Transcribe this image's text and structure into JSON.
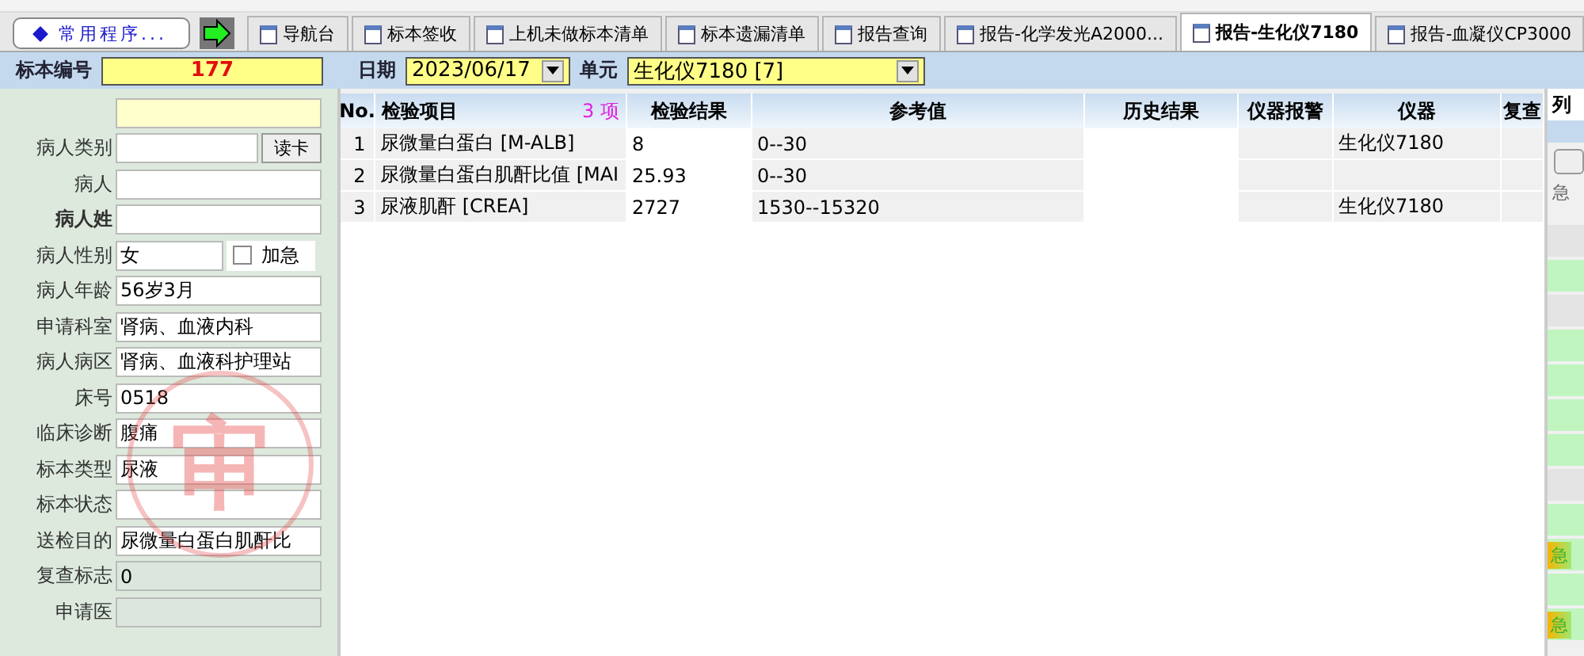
{
  "quick_button": {
    "label": "常用程序..."
  },
  "tabs": [
    {
      "label": "导航台",
      "selected": false
    },
    {
      "label": "标本签收",
      "selected": false
    },
    {
      "label": "上机未做标本清单",
      "selected": false
    },
    {
      "label": "标本遗漏清单",
      "selected": false
    },
    {
      "label": "报告查询",
      "selected": false
    },
    {
      "label": "报告-化学发光A2000...",
      "selected": false
    },
    {
      "label": "报告-生化仪7180",
      "selected": true
    },
    {
      "label": "报告-血凝仪CP3000",
      "selected": false
    }
  ],
  "header": {
    "sample_label": "标本编号",
    "sample_no": "177",
    "date_label": "日期",
    "date": "2023/06/17",
    "unit_label": "单元",
    "unit": "生化仪7180 [7]"
  },
  "patient_fields": [
    {
      "kind": "text",
      "disabled": false,
      "highlight": true
    },
    {
      "kind": "button",
      "label": "病人类别",
      "disabled": false,
      "highlight": false,
      "button": "读卡"
    },
    {
      "kind": "text",
      "label": "病人",
      "disabled": false,
      "highlight": false
    },
    {
      "kind": "text",
      "label": "病人姓",
      "disabled": false,
      "highlight": false,
      "bold": true
    },
    {
      "kind": "checkbox",
      "label": "病人性别",
      "value": "女",
      "disabled": false,
      "highlight": false,
      "check_label": "加急",
      "checked": false
    },
    {
      "kind": "text",
      "label": "病人年龄",
      "value": "56岁3月",
      "disabled": false,
      "highlight": false
    },
    {
      "kind": "text",
      "label": "申请科室",
      "value": "肾病、血液内科",
      "disabled": false,
      "highlight": false
    },
    {
      "kind": "text",
      "label": "病人病区",
      "value": "肾病、血液科护理站",
      "disabled": false,
      "highlight": false
    },
    {
      "kind": "text",
      "label": "床号",
      "value": "0518",
      "disabled": false,
      "highlight": false
    },
    {
      "kind": "text",
      "label": "临床诊断",
      "value": "腹痛",
      "disabled": false,
      "highlight": false
    },
    {
      "kind": "text",
      "label": "标本类型",
      "value": "尿液",
      "disabled": false,
      "highlight": false
    },
    {
      "kind": "text",
      "label": "标本状态",
      "disabled": false,
      "highlight": false
    },
    {
      "kind": "text",
      "label": "送检目的",
      "value": "尿微量白蛋白肌酐比",
      "disabled": false,
      "highlight": false
    },
    {
      "kind": "text",
      "label": "复查标志",
      "value": "0",
      "disabled": true,
      "highlight": false
    },
    {
      "kind": "text",
      "label": "申请医",
      "disabled": true,
      "highlight": false
    }
  ],
  "stamp": {
    "text": "审"
  },
  "table": {
    "count": "3 项",
    "columns": [
      "No.",
      "检验项目",
      "检验结果",
      "参考值",
      "历史结果",
      "仪器报警",
      "仪器",
      "复查"
    ],
    "rows": [
      [
        "1",
        "尿微量白蛋白 [M-ALB]",
        "8",
        "0--30",
        null,
        null,
        "生化仪7180",
        null
      ],
      [
        "2",
        "尿微量白蛋白肌酐比值 [MAI",
        "25.93",
        "0--30",
        null,
        null,
        null,
        null
      ],
      [
        "3",
        "尿液肌酐 [CREA]",
        "2727",
        "1530--15320",
        null,
        null,
        "生化仪7180",
        null
      ]
    ]
  },
  "side_panel": {
    "tab": "列",
    "header": "急",
    "rows": [
      {
        "highlight": false
      },
      {
        "highlight": true
      },
      {
        "highlight": false
      },
      {
        "highlight": true
      },
      {
        "highlight": true
      },
      {
        "highlight": true
      },
      {
        "highlight": true
      },
      {
        "highlight": false
      },
      {
        "highlight": true
      },
      {
        "highlight": true,
        "badge": "急"
      },
      {
        "highlight": true
      },
      {
        "highlight": true,
        "badge": "急"
      }
    ]
  }
}
